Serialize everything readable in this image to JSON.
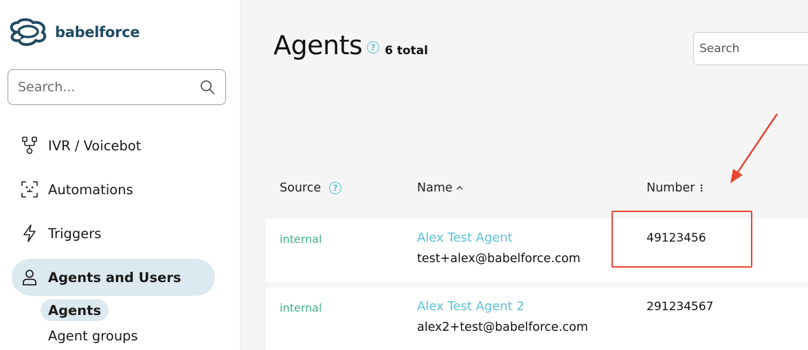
{
  "brand": {
    "name": "babelforce",
    "color": "#1f4b63"
  },
  "sidebar": {
    "search_placeholder": "Search...",
    "items": [
      {
        "label": "IVR / Voicebot",
        "icon": "flow-icon"
      },
      {
        "label": "Automations",
        "icon": "automation-icon"
      },
      {
        "label": "Triggers",
        "icon": "lightning-icon"
      },
      {
        "label": "Agents and Users",
        "icon": "user-icon",
        "active": true
      }
    ],
    "sub_items": [
      {
        "label": "Agents",
        "active": true
      },
      {
        "label": "Agent groups"
      }
    ]
  },
  "main": {
    "title": "Agents",
    "total": "6 total",
    "search_placeholder": "Search",
    "columns": {
      "source": "Source",
      "name": "Name",
      "number": "Number"
    },
    "rows": [
      {
        "source": "internal",
        "name": "Alex Test Agent",
        "email": "test+alex@babelforce.com",
        "number": "49123456"
      },
      {
        "source": "internal",
        "name": "Alex Test Agent 2",
        "email": "alex2+test@babelforce.com",
        "number": "291234567"
      }
    ]
  },
  "colors": {
    "accent": "#5bc0d8",
    "source_green": "#3fb37f",
    "active_bg": "#dde9f1",
    "annotation": "#e8442e"
  }
}
